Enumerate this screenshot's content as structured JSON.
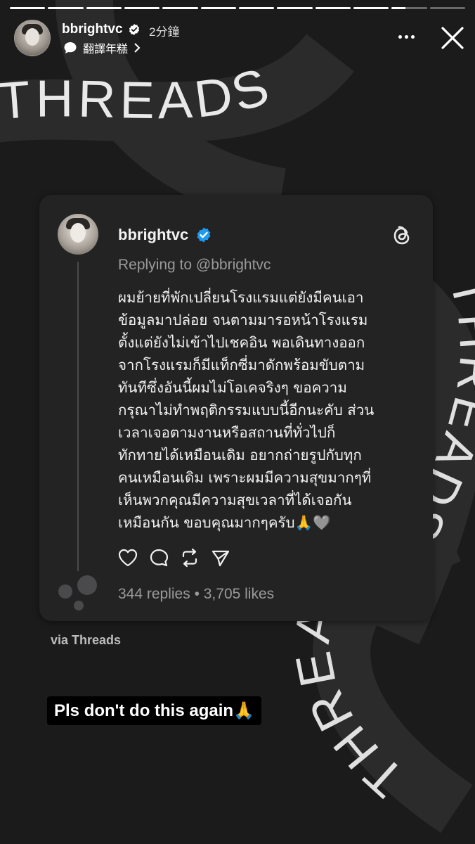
{
  "story": {
    "progress": [
      1,
      1,
      1,
      1,
      1,
      1,
      1,
      1,
      1,
      1,
      0.4,
      0
    ],
    "username": "bbrightvc",
    "time": "2分鐘",
    "translate_label": "翻譯年糕",
    "background_text": "THREADS"
  },
  "card": {
    "username": "bbrightvc",
    "replying_to": "Replying to @bbrightvc",
    "body": "ผมย้ายที่พักเปลี่ยนโรงแรมแต่ยังมีคนเอา\nข้อมูลมาปล่อย จนตามมารอหน้าโรงแรม\nตั้งแต่ยังไม่เข้าไปเชคอิน พอเดินทางออก\nจากโรงแรมก็มีแท็กซี่มาดักพร้อมขับตาม\nทันทีซึ่งอันนี้ผมไม่โอเคจริงๆ ขอความ\nกรุณาไม่ทำพฤติกรรมแบบนี้อีกนะคับ ส่วน\nเวลาเจอตามงานหรือสถานที่ทั่วไปก็\nทักทายได้เหมือนเดิม อยากถ่ายรูปกับทุก\nคนเหมือนเดิม เพราะผมมีความสุขมากๆที่\nเห็นพวกคุณมีความสุขเวลาที่ได้เจอกัน\nเหมือนกัน  ขอบคุณมากๆครับ🙏🩶",
    "stats": "344 replies • 3,705 likes"
  },
  "via": "via Threads",
  "caption": "Pls don't do this again🙏",
  "colors": {
    "verified": "#1d9bf0",
    "card_bg": "#232324",
    "page_bg": "#1b1b1b"
  },
  "icons": [
    "verified-badge-icon",
    "speech-bubble-icon",
    "chevron-right-icon",
    "more-dots-icon",
    "close-icon",
    "threads-logo-icon",
    "heart-icon",
    "comment-icon",
    "repost-icon",
    "share-icon"
  ]
}
